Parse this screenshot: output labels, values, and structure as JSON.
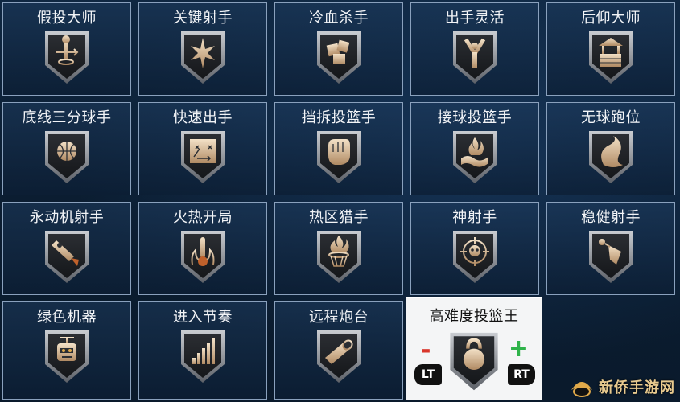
{
  "badges": [
    {
      "label": "假投大师",
      "icon": "fake-shot-icon"
    },
    {
      "label": "关键射手",
      "icon": "star-burst-icon"
    },
    {
      "label": "冷血杀手",
      "icon": "ice-cubes-icon"
    },
    {
      "label": "出手灵活",
      "icon": "slingshot-icon"
    },
    {
      "label": "后仰大师",
      "icon": "wishing-well-icon"
    },
    {
      "label": "底线三分球手",
      "icon": "basketball-corner-icon"
    },
    {
      "label": "快速出手",
      "icon": "play-diagram-icon"
    },
    {
      "label": "挡拆投篮手",
      "icon": "fist-icon"
    },
    {
      "label": "接球投篮手",
      "icon": "hand-flame-icon"
    },
    {
      "label": "无球跑位",
      "icon": "swirl-icon"
    },
    {
      "label": "永动机射手",
      "icon": "rocket-icon"
    },
    {
      "label": "火热开局",
      "icon": "thermometer-icon"
    },
    {
      "label": "热区猎手",
      "icon": "flaming-hoop-icon"
    },
    {
      "label": "神射手",
      "icon": "crosshair-skull-icon"
    },
    {
      "label": "稳健射手",
      "icon": "trophy-icon"
    },
    {
      "label": "绿色机器",
      "icon": "robot-icon"
    },
    {
      "label": "进入节奏",
      "icon": "signal-bars-icon"
    },
    {
      "label": "远程炮台",
      "icon": "cannon-icon"
    }
  ],
  "selected_badge": {
    "label": "高难度投篮王",
    "icon": "kettlebell-icon",
    "decrease_symbol": "-",
    "increase_symbol": "+",
    "left_trigger": "LT",
    "right_trigger": "RT"
  },
  "watermark": {
    "text": "新侨手游网"
  }
}
